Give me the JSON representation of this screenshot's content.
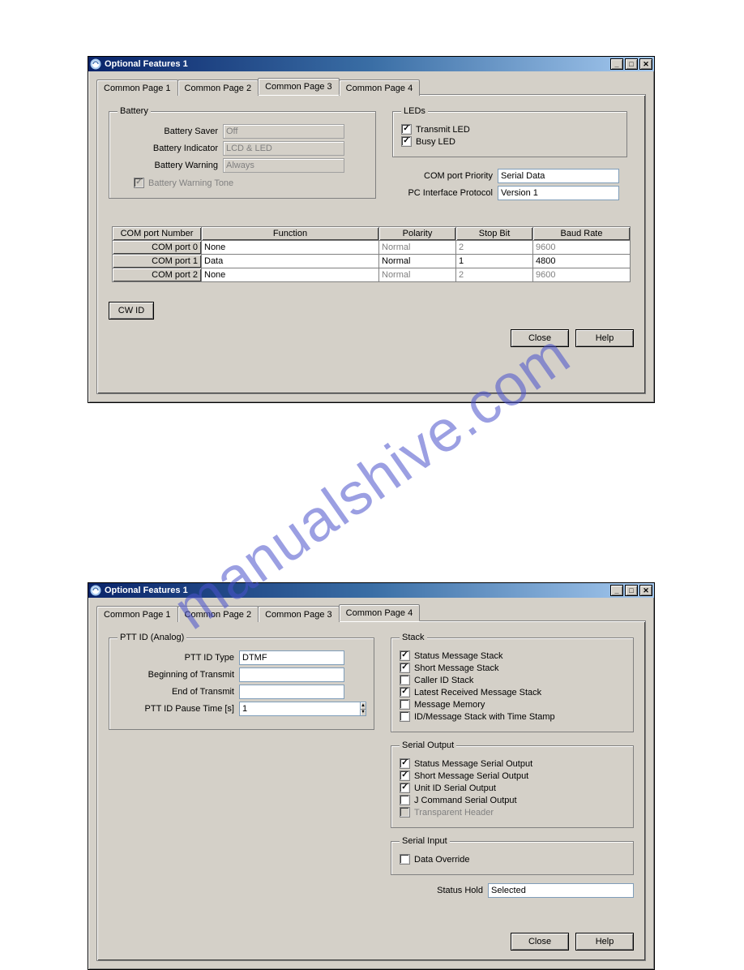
{
  "watermark": "manualshive.com",
  "win1": {
    "title": "Optional Features 1",
    "tabs": [
      "Common Page 1",
      "Common Page 2",
      "Common Page 3",
      "Common Page 4"
    ],
    "active_tab": 2,
    "battery": {
      "legend": "Battery",
      "saver_label": "Battery Saver",
      "saver_value": "Off",
      "indicator_label": "Battery Indicator",
      "indicator_value": "LCD & LED",
      "warning_label": "Battery Warning",
      "warning_value": "Always",
      "tone_label": "Battery Warning Tone",
      "tone_checked": true
    },
    "leds": {
      "legend": "LEDs",
      "transmit_label": "Transmit LED",
      "transmit_checked": true,
      "busy_label": "Busy LED",
      "busy_checked": true
    },
    "com_priority_label": "COM port Priority",
    "com_priority_value": "Serial Data",
    "pc_interface_label": "PC Interface Protocol",
    "pc_interface_value": "Version 1",
    "table": {
      "headers": [
        "COM port Number",
        "Function",
        "Polarity",
        "Stop Bit",
        "Baud Rate"
      ],
      "rows": [
        {
          "name": "COM port 0",
          "function": "None",
          "polarity": "Normal",
          "stop": "2",
          "baud": "9600",
          "disabled": true
        },
        {
          "name": "COM port 1",
          "function": "Data",
          "polarity": "Normal",
          "stop": "1",
          "baud": "4800",
          "disabled": false
        },
        {
          "name": "COM port 2",
          "function": "None",
          "polarity": "Normal",
          "stop": "2",
          "baud": "9600",
          "disabled": true
        }
      ]
    },
    "cwid_label": "CW ID",
    "close_label": "Close",
    "help_label": "Help"
  },
  "win2": {
    "title": "Optional Features 1",
    "tabs": [
      "Common Page 1",
      "Common Page 2",
      "Common Page 3",
      "Common Page 4"
    ],
    "active_tab": 3,
    "ptt": {
      "legend": "PTT ID (Analog)",
      "type_label": "PTT ID Type",
      "type_value": "DTMF",
      "bot_label": "Beginning of Transmit",
      "bot_value": "",
      "eot_label": "End of Transmit",
      "eot_value": "",
      "pause_label": "PTT ID Pause Time [s]",
      "pause_value": "1"
    },
    "stack": {
      "legend": "Stack",
      "items": [
        {
          "label": "Status Message Stack",
          "checked": true,
          "disabled": false
        },
        {
          "label": "Short Message Stack",
          "checked": true,
          "disabled": false
        },
        {
          "label": "Caller ID Stack",
          "checked": false,
          "disabled": false
        },
        {
          "label": "Latest Received Message Stack",
          "checked": true,
          "disabled": false
        },
        {
          "label": "Message Memory",
          "checked": false,
          "disabled": false
        },
        {
          "label": "ID/Message Stack with Time Stamp",
          "checked": false,
          "disabled": false
        }
      ]
    },
    "serial_out": {
      "legend": "Serial Output",
      "items": [
        {
          "label": "Status Message Serial Output",
          "checked": true,
          "disabled": false
        },
        {
          "label": "Short Message Serial Output",
          "checked": true,
          "disabled": false
        },
        {
          "label": "Unit ID Serial Output",
          "checked": true,
          "disabled": false
        },
        {
          "label": "J Command Serial Output",
          "checked": false,
          "disabled": false
        },
        {
          "label": "Transparent Header",
          "checked": false,
          "disabled": true
        }
      ]
    },
    "serial_in": {
      "legend": "Serial Input",
      "override_label": "Data Override",
      "override_checked": false
    },
    "status_hold_label": "Status Hold",
    "status_hold_value": "Selected",
    "close_label": "Close",
    "help_label": "Help"
  }
}
